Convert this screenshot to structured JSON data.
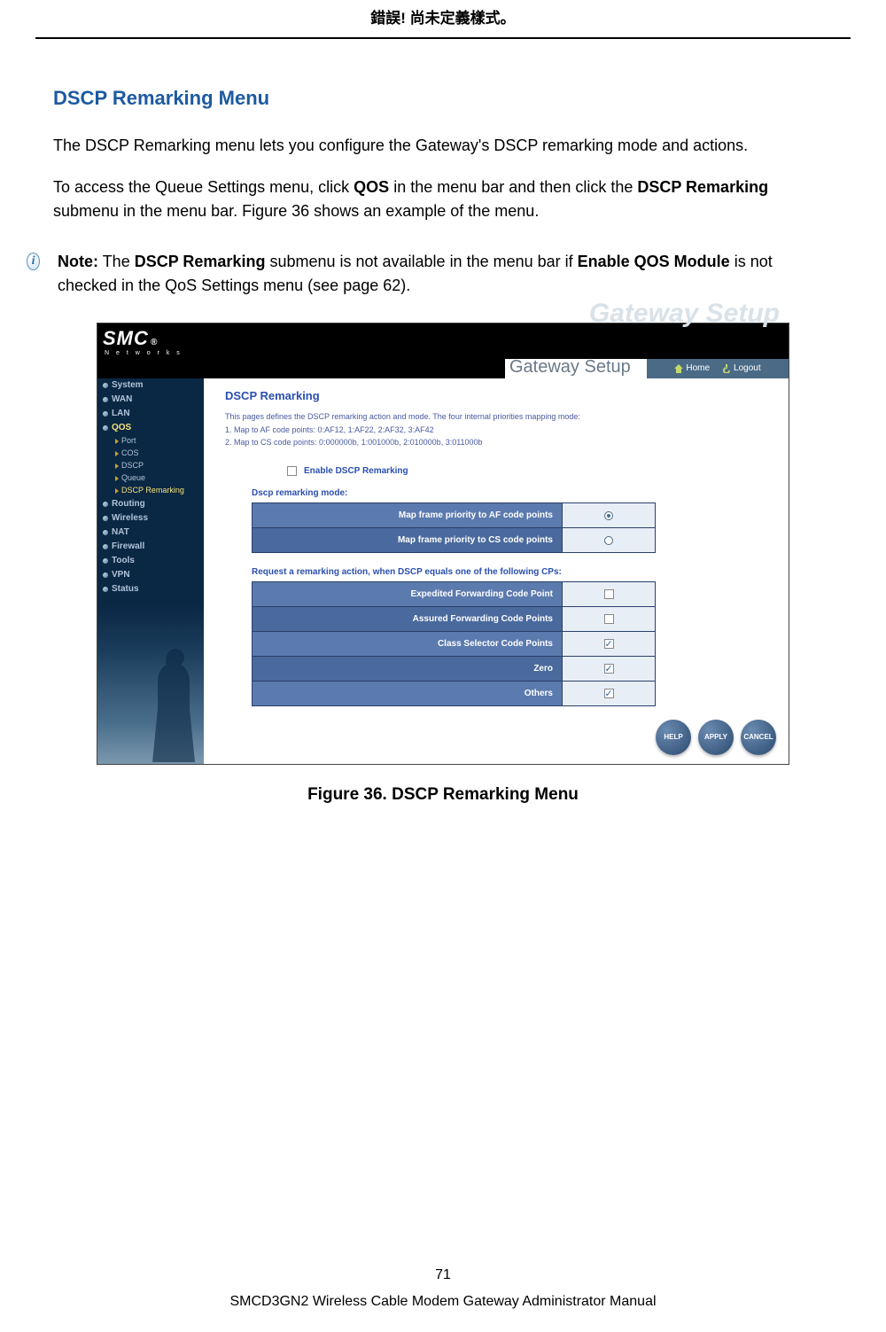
{
  "header_error": "錯誤! 尚未定義樣式。",
  "section_title": "DSCP Remarking Menu",
  "intro_para": "The DSCP Remarking menu lets you configure the Gateway's DSCP remarking mode and actions.",
  "access_pre": "To access the Queue Settings menu, click ",
  "access_qos": "QOS",
  "access_mid": " in the menu bar and then click the ",
  "access_dscp": "DSCP Remarking",
  "access_post": " submenu in the menu bar. Figure 36 shows an example of the menu.",
  "note_label": "Note:",
  "note_pre": " The ",
  "note_b1": "DSCP Remarking",
  "note_mid1": " submenu is not available in the menu bar if ",
  "note_b2": "Enable QOS Module",
  "note_post": " is not checked in the QoS Settings menu (see page 62).",
  "figure_caption": "Figure 36. DSCP Remarking Menu",
  "page_number": "71",
  "footer_text": "SMCD3GN2 Wireless Cable Modem Gateway Administrator Manual",
  "ui": {
    "logo": "SMC",
    "logo_sub": "N e t w o r k s",
    "watermark": "Gateway Setup",
    "banner_title": "Gateway Setup",
    "home": "Home",
    "logout": "Logout",
    "sidebar": {
      "items": [
        "System",
        "WAN",
        "LAN",
        "QOS",
        "Routing",
        "Wireless",
        "NAT",
        "Firewall",
        "Tools",
        "VPN",
        "Status"
      ],
      "subs": [
        "Port",
        "COS",
        "DSCP",
        "Queue",
        "DSCP Remarking"
      ]
    },
    "page_heading": "DSCP Remarking",
    "desc1": "This pages defines the DSCP remarking action and mode. The four internal priorities mapping mode:",
    "desc2": "1. Map to AF code points: 0:AF12, 1:AF22, 2:AF32, 3:AF42",
    "desc3": "2. Map to CS code points: 0:000000b, 1:001000b, 2:010000b, 3:011000b",
    "enable_label": "Enable DSCP Remarking",
    "mode_label": "Dscp remarking mode:",
    "mode_rows": [
      "Map frame priority to AF code points",
      "Map frame priority to CS code points"
    ],
    "req_label": "Request a remarking action, when DSCP equals one of the following CPs:",
    "cp_rows": [
      "Expedited Forwarding Code Point",
      "Assured Forwarding Code Points",
      "Class Selector Code Points",
      "Zero",
      "Others"
    ],
    "btn_help": "HELP",
    "btn_apply": "APPLY",
    "btn_cancel": "CANCEL"
  }
}
